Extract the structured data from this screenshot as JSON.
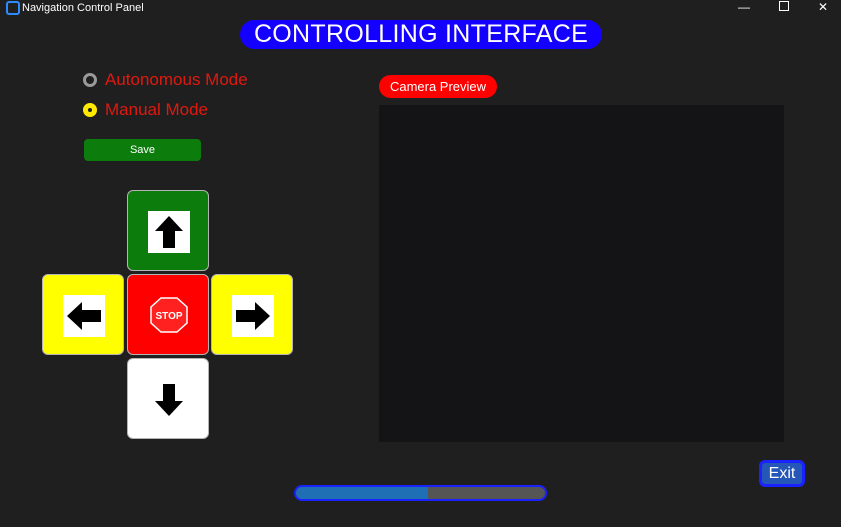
{
  "window": {
    "title": "Navigation Control Panel",
    "minimize_glyph": "—",
    "close_glyph": "✕"
  },
  "header": {
    "title": "CONTROLLING INTERFACE"
  },
  "mode": {
    "options": [
      {
        "label": "Autonomous Mode",
        "selected": false
      },
      {
        "label": "Manual Mode",
        "selected": true
      }
    ],
    "save_label": "Save"
  },
  "dpad": {
    "forward_icon": "arrow-up-icon",
    "left_icon": "arrow-left-icon",
    "stop_icon": "stop-sign-icon",
    "stop_text": "STOP",
    "right_icon": "arrow-right-icon",
    "backward_icon": "arrow-down-icon",
    "colors": {
      "forward": "#0c7d0c",
      "turn": "#ffff00",
      "stop": "#ff0000",
      "backward": "#ffffff"
    }
  },
  "camera": {
    "label": "Camera Preview"
  },
  "footer": {
    "exit_label": "Exit",
    "progress_fraction": 0.53
  },
  "colors": {
    "title_bg": "#1400ff",
    "mode_text": "#e0190f",
    "radio_selected": "#ffea00",
    "camera_label_bg": "#ff0000",
    "progress_fill": "#1f6fb5"
  }
}
